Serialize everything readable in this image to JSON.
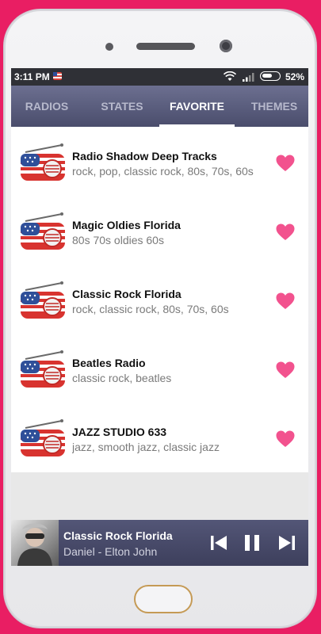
{
  "status": {
    "time": "3:11 PM",
    "battery": "52%"
  },
  "tabs": [
    {
      "label": "RADIOS"
    },
    {
      "label": "STATES"
    },
    {
      "label": "FAVORITE"
    },
    {
      "label": "THEMES"
    }
  ],
  "favorites": [
    {
      "title": "Radio Shadow Deep Tracks",
      "tags": "rock, pop, classic rock, 80s, 70s, 60s"
    },
    {
      "title": "Magic Oldies Florida",
      "tags": "80s 70s oldies 60s"
    },
    {
      "title": "Classic Rock Florida",
      "tags": "rock, classic rock, 80s, 70s, 60s"
    },
    {
      "title": "Beatles Radio",
      "tags": "classic rock, beatles"
    },
    {
      "title": "JAZZ STUDIO 633",
      "tags": "jazz, smooth jazz, classic jazz"
    }
  ],
  "player": {
    "station": "Classic Rock Florida",
    "track": "Daniel - Elton John"
  },
  "colors": {
    "background": "#e91e63",
    "heart": "#f2528e",
    "tabbar": "#5a5d7e"
  },
  "icons": {
    "item": "us-flag-radio-icon",
    "favorite": "heart-icon",
    "controls": [
      "skip-previous-icon",
      "pause-icon",
      "skip-next-icon"
    ]
  }
}
